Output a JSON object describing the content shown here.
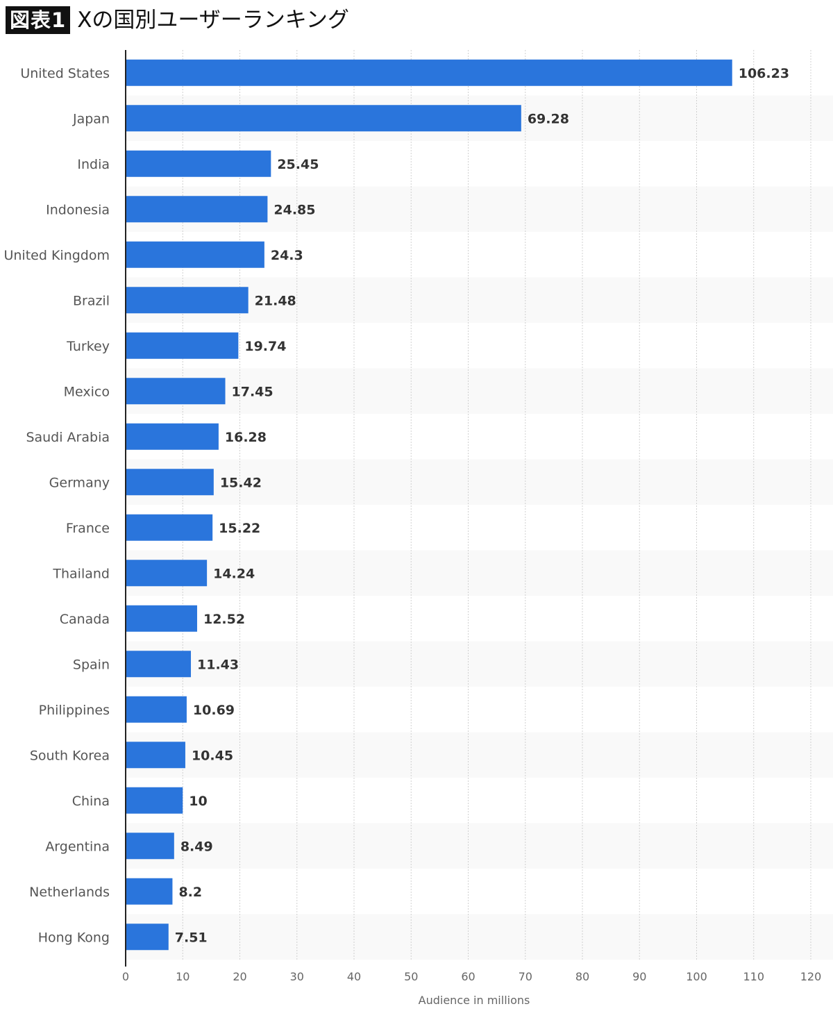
{
  "header": {
    "badge": "図表1",
    "title": "Xの国別ユーザーランキング"
  },
  "chart_data": {
    "type": "bar",
    "orientation": "horizontal",
    "title": "Xの国別ユーザーランキング",
    "xlabel": "Audience in millions",
    "ylabel": "",
    "xlim": [
      0,
      120
    ],
    "xticks": [
      0,
      10,
      20,
      30,
      40,
      50,
      60,
      70,
      80,
      90,
      100,
      110,
      120
    ],
    "grid": true,
    "bar_color": "#2a75dc",
    "categories": [
      "United States",
      "Japan",
      "India",
      "Indonesia",
      "United Kingdom",
      "Brazil",
      "Turkey",
      "Mexico",
      "Saudi Arabia",
      "Germany",
      "France",
      "Thailand",
      "Canada",
      "Spain",
      "Philippines",
      "South Korea",
      "China",
      "Argentina",
      "Netherlands",
      "Hong Kong"
    ],
    "values": [
      106.23,
      69.28,
      25.45,
      24.85,
      24.3,
      21.48,
      19.74,
      17.45,
      16.28,
      15.42,
      15.22,
      14.24,
      12.52,
      11.43,
      10.69,
      10.45,
      10,
      8.49,
      8.2,
      7.51
    ],
    "value_labels": [
      "106.23",
      "69.28",
      "25.45",
      "24.85",
      "24.3",
      "21.48",
      "19.74",
      "17.45",
      "16.28",
      "15.42",
      "15.22",
      "14.24",
      "12.52",
      "11.43",
      "10.69",
      "10.45",
      "10",
      "8.49",
      "8.2",
      "7.51"
    ]
  }
}
